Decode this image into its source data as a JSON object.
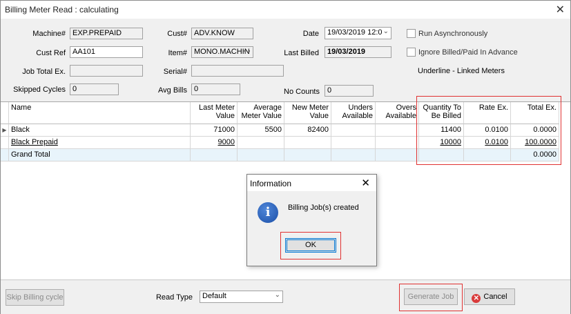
{
  "window": {
    "title": "Billing Meter Read : calculating"
  },
  "form": {
    "machine_label": "Machine#",
    "machine_value": "EXP.PREPAID",
    "custno_label": "Cust#",
    "custno_value": "ADV.KNOW",
    "date_label": "Date",
    "date_value": "19/03/2019 12:0",
    "run_async_label": "Run Asynchronously",
    "custref_label": "Cust Ref",
    "custref_value": "AA101",
    "item_label": "Item#",
    "item_value": "MONO.MACHIN",
    "lastbilled_label": "Last Billed",
    "lastbilled_value": "19/03/2019",
    "ignore_label": "Ignore Billed/Paid In Advance",
    "jobtotal_label": "Job Total Ex.",
    "jobtotal_value": "",
    "serial_label": "Serial#",
    "serial_value": "",
    "underline_note": "Underline - Linked Meters",
    "skipped_label": "Skipped Cycles",
    "skipped_value": "0",
    "avgbills_label": "Avg Bills",
    "avgbills_value": "0",
    "nocounts_label": "No Counts",
    "nocounts_value": "0"
  },
  "grid": {
    "headers": {
      "name": "Name",
      "last_meter": [
        "Last Meter",
        "Value"
      ],
      "avg_meter": [
        "Average",
        "Meter Value"
      ],
      "new_meter": [
        "New Meter",
        "Value"
      ],
      "unders": [
        "Unders",
        "Available"
      ],
      "overs": [
        "Overs",
        "Available"
      ],
      "qty": [
        "Quantity To",
        "Be Billed"
      ],
      "rate": "Rate Ex.",
      "total": "Total Ex."
    },
    "rows": [
      {
        "name": "Black",
        "last": "71000",
        "avg": "5500",
        "new": "82400",
        "unders": "",
        "overs": "",
        "qty": "11400",
        "rate": "0.0100",
        "total": "0.0000"
      },
      {
        "name": "Black Prepaid",
        "last": "9000",
        "avg": "",
        "new": "",
        "unders": "",
        "overs": "",
        "qty": "10000",
        "rate": "0.0100",
        "total": "100.0000"
      }
    ],
    "grand_total": {
      "name": "Grand Total",
      "total": "0.0000"
    }
  },
  "dialog": {
    "title": "Information",
    "message": "Billing Job(s) created",
    "ok_label": "OK",
    "icon": "info-icon"
  },
  "footer": {
    "skip_label": "Skip Billing cycle",
    "readtype_label": "Read Type",
    "readtype_value": "Default",
    "generate_label": "Generate Job",
    "cancel_label": "Cancel"
  },
  "colors": {
    "highlight": "#e03030",
    "accent": "#0078d7",
    "total_row": "#e8f4fb"
  }
}
